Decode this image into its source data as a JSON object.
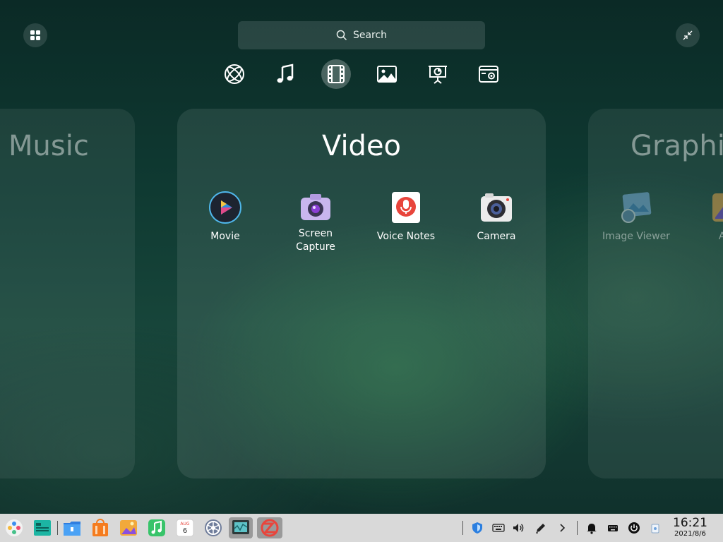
{
  "search": {
    "label": "Search"
  },
  "categories": [
    {
      "name": "network"
    },
    {
      "name": "music"
    },
    {
      "name": "video",
      "active": true
    },
    {
      "name": "graphics"
    },
    {
      "name": "office"
    },
    {
      "name": "system"
    }
  ],
  "panels": {
    "left": {
      "title": "Music"
    },
    "center": {
      "title": "Video",
      "apps": [
        {
          "label": "Movie"
        },
        {
          "label": "Screen\nCapture"
        },
        {
          "label": "Voice Notes"
        },
        {
          "label": "Camera"
        }
      ]
    },
    "right": {
      "title": "Graphic",
      "apps": [
        {
          "label": "Image Viewer"
        },
        {
          "label": "Alb"
        }
      ]
    }
  },
  "taskbar": {
    "calendar": {
      "month": "AUG",
      "day": "6"
    },
    "clock": {
      "time": "16:21",
      "date": "2021/8/6"
    }
  },
  "colors": {
    "accent_red": "#e8453c",
    "movie_blue": "#2a8de0"
  }
}
